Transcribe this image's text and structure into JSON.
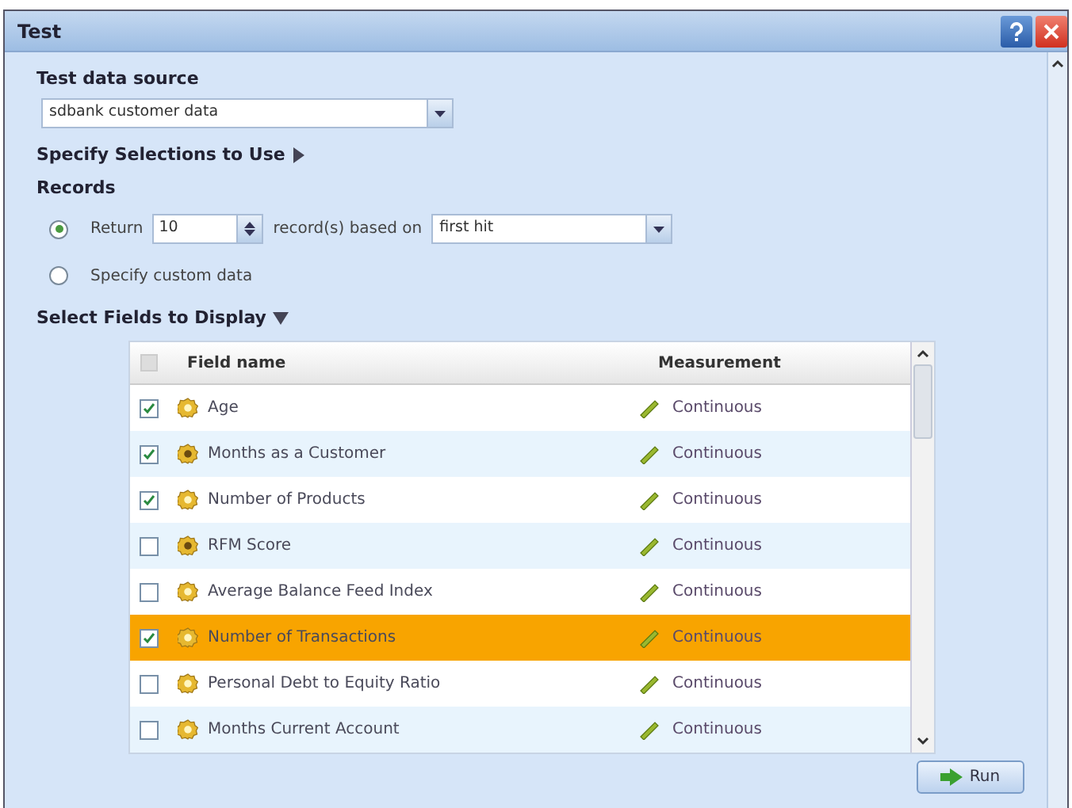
{
  "window": {
    "title": "Test"
  },
  "data_source": {
    "label": "Test data source",
    "value": "sdbank customer data"
  },
  "selections": {
    "label": "Specify Selections to Use",
    "expanded": false
  },
  "records": {
    "label": "Records",
    "options": [
      {
        "kind": "return",
        "selected": true,
        "label": "Return",
        "count": "10",
        "middle": "record(s) based on",
        "basis": "first hit"
      },
      {
        "kind": "custom",
        "selected": false,
        "label": "Specify custom data"
      }
    ]
  },
  "fields": {
    "label": "Select Fields to Display",
    "expanded": true,
    "columns": [
      "Field name",
      "Measurement"
    ],
    "rows": [
      {
        "checked": true,
        "selected": false,
        "kind": "plain",
        "name": "Age",
        "measurement": "Continuous"
      },
      {
        "checked": true,
        "selected": false,
        "kind": "dotted",
        "name": "Months as a Customer",
        "measurement": "Continuous"
      },
      {
        "checked": true,
        "selected": false,
        "kind": "plain",
        "name": "Number of Products",
        "measurement": "Continuous"
      },
      {
        "checked": false,
        "selected": false,
        "kind": "dotted",
        "name": "RFM Score",
        "measurement": "Continuous"
      },
      {
        "checked": false,
        "selected": false,
        "kind": "plain",
        "name": "Average Balance Feed Index",
        "measurement": "Continuous"
      },
      {
        "checked": true,
        "selected": true,
        "kind": "plain",
        "name": "Number of Transactions",
        "measurement": "Continuous"
      },
      {
        "checked": false,
        "selected": false,
        "kind": "plain",
        "name": "Personal Debt to Equity Ratio",
        "measurement": "Continuous"
      },
      {
        "checked": false,
        "selected": false,
        "kind": "plain",
        "name": "Months Current Account",
        "measurement": "Continuous"
      }
    ]
  },
  "run_button": "Run"
}
